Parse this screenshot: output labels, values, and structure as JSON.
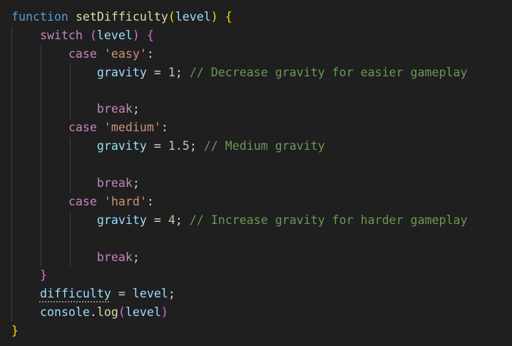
{
  "code": {
    "kw_function": "function",
    "fn_name": "setDifficulty",
    "param": "level",
    "kw_switch": "switch",
    "switch_arg": "level",
    "kw_case": "case",
    "kw_break": "break",
    "var_gravity": "gravity",
    "cases": [
      {
        "label": "'easy'",
        "value": "1",
        "comment": "// Decrease gravity for easier gameplay"
      },
      {
        "label": "'medium'",
        "value": "1.5",
        "comment": "// Medium gravity"
      },
      {
        "label": "'hard'",
        "value": "4",
        "comment": "// Increase gravity for harder gameplay"
      }
    ],
    "var_difficulty": "difficulty",
    "assign_value": "level",
    "obj_console": "console",
    "method_log": "log",
    "log_arg": "level"
  },
  "colors": {
    "background": "#1f1f1f",
    "keyword": "#569cd6",
    "control": "#c586c0",
    "function": "#dcdcaa",
    "variable": "#9cdcfe",
    "string": "#ce9178",
    "number": "#b5cea8",
    "comment": "#6a9955"
  }
}
